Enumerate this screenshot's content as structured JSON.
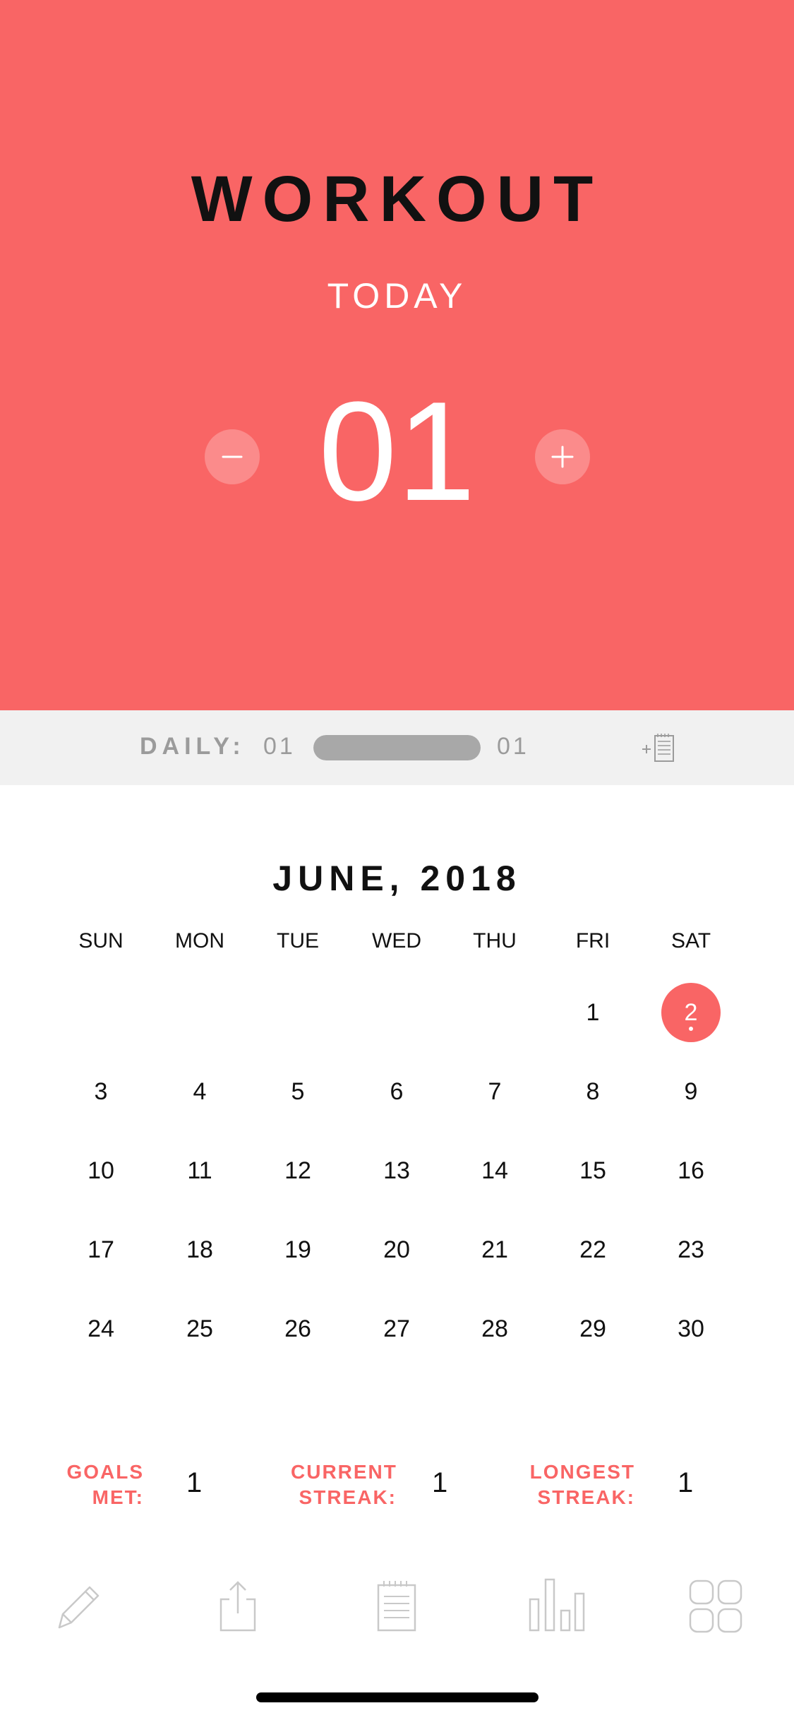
{
  "hero": {
    "title": "WORKOUT",
    "subtitle": "TODAY",
    "count": "01",
    "background_color": "#F96565",
    "decrement_icon": "minus-icon",
    "increment_icon": "plus-icon"
  },
  "daily": {
    "label": "DAILY:",
    "current": "01",
    "goal": "01",
    "progress": 1.0,
    "action_icon": "add-note-icon"
  },
  "calendar": {
    "month": "JUNE, 2018",
    "weekdays": [
      "SUN",
      "MON",
      "TUE",
      "WED",
      "THU",
      "FRI",
      "SAT"
    ],
    "selected_day": "2",
    "weeks": [
      [
        "",
        "",
        "",
        "",
        "",
        "1",
        "2"
      ],
      [
        "3",
        "4",
        "5",
        "6",
        "7",
        "8",
        "9"
      ],
      [
        "10",
        "11",
        "12",
        "13",
        "14",
        "15",
        "16"
      ],
      [
        "17",
        "18",
        "19",
        "20",
        "21",
        "22",
        "23"
      ],
      [
        "24",
        "25",
        "26",
        "27",
        "28",
        "29",
        "30"
      ]
    ]
  },
  "stats": [
    {
      "label_line1": "GOALS",
      "label_line2": "MET:",
      "value": "1"
    },
    {
      "label_line1": "CURRENT",
      "label_line2": "STREAK:",
      "value": "1"
    },
    {
      "label_line1": "LONGEST",
      "label_line2": "STREAK:",
      "value": "1"
    }
  ],
  "tabbar": {
    "items": [
      "edit-icon",
      "share-icon",
      "notes-icon",
      "stats-icon",
      "grid-icon"
    ]
  }
}
